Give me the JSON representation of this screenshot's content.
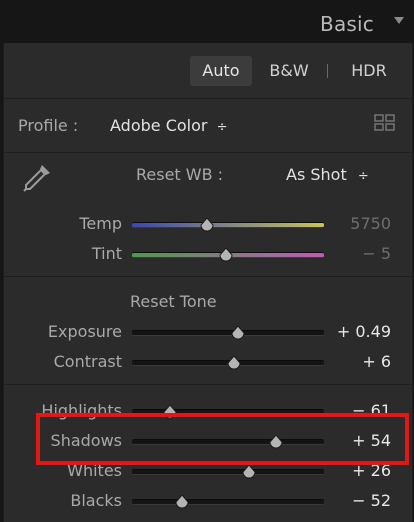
{
  "panel": {
    "title": "Basic"
  },
  "modes": {
    "auto": "Auto",
    "bw": "B&W",
    "hdr": "HDR"
  },
  "profile": {
    "label": "Profile :",
    "value": "Adobe Color",
    "chevron": "÷"
  },
  "wb": {
    "reset_label": "Reset WB :",
    "value": "As Shot",
    "chevron": "÷"
  },
  "temp": {
    "label": "Temp",
    "value": "5750",
    "level": 0.39
  },
  "tint": {
    "label": "Tint",
    "value": "− 5",
    "level": 0.49
  },
  "tone": {
    "reset_label": "Reset Tone"
  },
  "exposure": {
    "label": "Exposure",
    "value": "+ 0.49",
    "level": 0.55
  },
  "contrast": {
    "label": "Contrast",
    "value": "+ 6",
    "level": 0.53
  },
  "highlights": {
    "label": "Highlights",
    "value": "− 61",
    "level": 0.2
  },
  "shadows": {
    "label": "Shadows",
    "value": "+ 54",
    "level": 0.75
  },
  "whites": {
    "label": "Whites",
    "value": "+ 26",
    "level": 0.61
  },
  "blacks": {
    "label": "Blacks",
    "value": "− 52",
    "level": 0.26
  },
  "icons": {
    "collapse": "triangle-down-icon",
    "grid": "profile-browser-grid-icon",
    "eyedropper": "eyedropper-icon"
  },
  "colors": {
    "annotation": "#e01818"
  }
}
